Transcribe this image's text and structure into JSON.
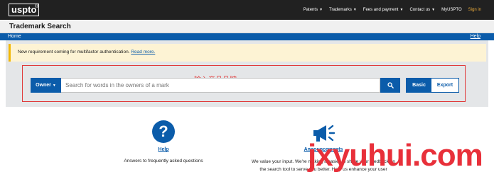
{
  "header": {
    "logo_text": "uspto",
    "logo_mark": "®",
    "nav": [
      {
        "label": "Patents",
        "caret": "▼"
      },
      {
        "label": "Trademarks",
        "caret": "▼"
      },
      {
        "label": "Fees and payment",
        "caret": "▼"
      },
      {
        "label": "Contact us",
        "caret": "▼"
      },
      {
        "label": "MyUSPTO"
      },
      {
        "label": "Sign in"
      }
    ]
  },
  "page": {
    "title": "Trademark Search",
    "home_link": "Home",
    "help_link": "Help"
  },
  "alert": {
    "text": "New requirement coming for multifactor authentication.",
    "link": "Read more."
  },
  "search": {
    "field_selector": "Owner",
    "field_caret": "▼",
    "placeholder": "Search for words in the owners of a mark",
    "value": "",
    "mode_basic": "Basic",
    "mode_export": "Export",
    "annotation": "输入竞品品牌"
  },
  "cards": {
    "help": {
      "icon": "question-mark-icon",
      "icon_glyph": "?",
      "title": "Help",
      "description": "Answers to frequently asked questions"
    },
    "announcements": {
      "icon": "megaphone-icon",
      "title": "Announcements",
      "description_line1": "We value your input. We're making it easier to share your feedback on",
      "description_line2": "the search tool to serve you better. Help us enhance your user"
    }
  },
  "watermark": "jxyuhui.com",
  "colors": {
    "primary_blue": "#0b5caa",
    "topbar": "#212121",
    "alert_bg": "#fdf3d4",
    "alert_border": "#f2b705",
    "annotation_red": "#e03a3a",
    "sign_in": "#e8a93a"
  }
}
